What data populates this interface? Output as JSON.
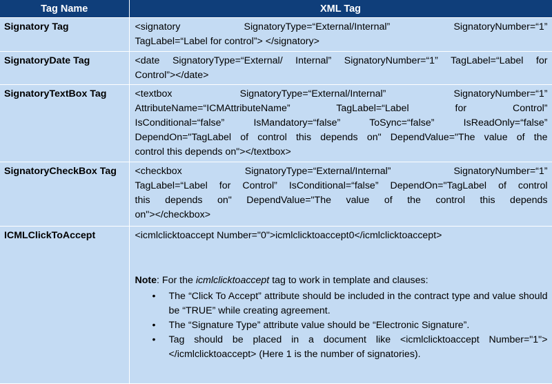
{
  "header": {
    "col1": "Tag Name",
    "col2": "XML Tag"
  },
  "rows": [
    {
      "name": "Signatory Tag",
      "lines": [
        "<signatory SignatoryType=“External/Internal” SignatoryNumber=“1”",
        "TagLabel=“Label for control”> </signatory>"
      ]
    },
    {
      "name": "SignatoryDate Tag",
      "lines": [
        "<date SignatoryType=“External/ Internal” SignatoryNumber=“1” TagLabel=“Label for",
        "Control”></date>"
      ]
    },
    {
      "name": "SignatoryTextBox Tag",
      "lines": [
        "<textbox SignatoryType=“External/Internal” SignatoryNumber=“1”",
        "AttributeName=“ICMAttributeName” TagLabel=“Label for Control”",
        "IsConditional=“false” IsMandatory=“false” ToSync=“false” IsReadOnly=“false”",
        "DependOn=\"TagLabel of control this depends on\" DependValue=\"The value of the",
        "control this depends on\"></textbox>"
      ]
    },
    {
      "name": "SignatoryCheckBox Tag",
      "lines": [
        "<checkbox SignatoryType=“External/Internal” SignatoryNumber=“1”",
        "TagLabel=“Label for Control” IsConditional=“false” DependOn=\"TagLabel of control",
        "this depends on\" DependValue=\"The value of the control this depends",
        "on\"></checkbox>"
      ]
    },
    {
      "name": "ICMLClickToAccept",
      "tag": "<icmlclicktoaccept Number=\"0\">icmlclicktoaccept0</icmlclicktoaccept>",
      "note": {
        "label": "Note",
        "text_before": ": For the ",
        "italic": "icmlclicktoaccept",
        "text_after": " tag to work in template and clauses:",
        "bullet": "•",
        "bullets": [
          "The “Click To Accept” attribute should be included in the contract type and value should be “TRUE” while creating agreement.",
          "The “Signature Type” attribute value should be “Electronic Signature”.",
          "Tag should be placed in a document like <icmlclicktoaccept Number=\"1\"> </icmlclicktoaccept> (Here 1 is the number of signatories)."
        ]
      }
    }
  ]
}
